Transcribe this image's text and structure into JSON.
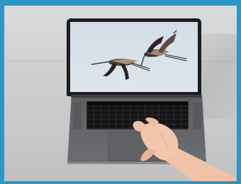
{
  "scene": {
    "description_icon": "laptop-icon",
    "screen_content_icon": "flying-cranes-icon",
    "colors": {
      "frame": "#2b97c9",
      "wall": "#d8d9da",
      "table": "#c9cacb",
      "laptop_lid": "#1d1d1f",
      "laptop_base": "#636568",
      "screen_sky": "#d7e0e8",
      "skin": "#f2c6ad"
    }
  }
}
